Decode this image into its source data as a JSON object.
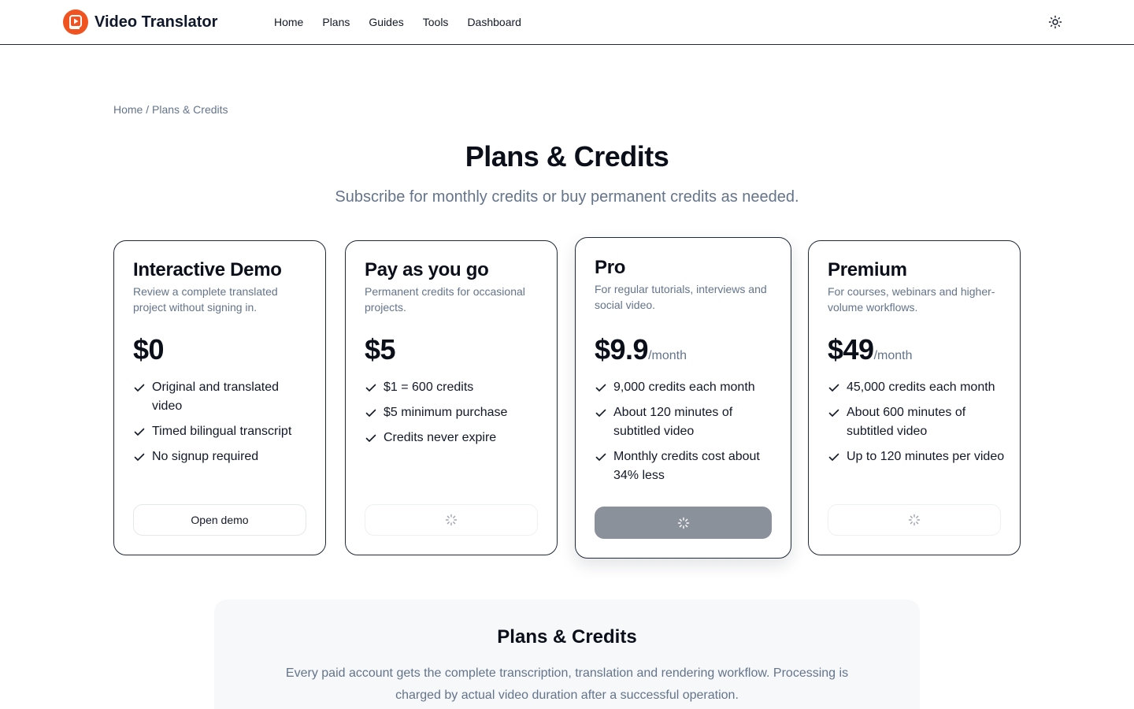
{
  "header": {
    "brand": "Video Translator",
    "nav": [
      "Home",
      "Plans",
      "Guides",
      "Tools",
      "Dashboard"
    ]
  },
  "breadcrumb": {
    "home": "Home",
    "separator": "/",
    "current": "Plans & Credits"
  },
  "page": {
    "title": "Plans & Credits",
    "subtitle": "Subscribe for monthly credits or buy permanent credits as needed."
  },
  "plans": [
    {
      "name": "Interactive Demo",
      "description": "Review a complete translated project without signing in.",
      "price": "$0",
      "period": "",
      "features": [
        "Original and translated video",
        "Timed bilingual transcript",
        "No signup required"
      ],
      "button": "Open demo"
    },
    {
      "name": "Pay as you go",
      "description": "Permanent credits for occasional projects.",
      "price": "$5",
      "period": "",
      "features": [
        "$1 = 600 credits",
        "$5 minimum purchase",
        "Credits never expire"
      ],
      "button": ""
    },
    {
      "name": "Pro",
      "description": "For regular tutorials, interviews and social video.",
      "price": "$9.9",
      "period": "/month",
      "features": [
        "9,000 credits each month",
        "About 120 minutes of subtitled video",
        "Monthly credits cost about 34% less"
      ],
      "button": ""
    },
    {
      "name": "Premium",
      "description": "For courses, webinars and higher-volume workflows.",
      "price": "$49",
      "period": "/month",
      "features": [
        "45,000 credits each month",
        "About 600 minutes of subtitled video",
        "Up to 120 minutes per video"
      ],
      "button": ""
    }
  ],
  "info": {
    "title": "Plans & Credits",
    "text": "Every paid account gets the complete transcription, translation and rendering workflow. Processing is charged by actual video duration after a successful operation."
  },
  "colors": {
    "brand": "#f0531f",
    "primary_button_loading": "#8b919b",
    "muted_text": "#64748b"
  },
  "icons": {
    "theme_toggle": "sun-icon",
    "feature_bullet": "check-icon",
    "loading": "spinner-icon"
  }
}
